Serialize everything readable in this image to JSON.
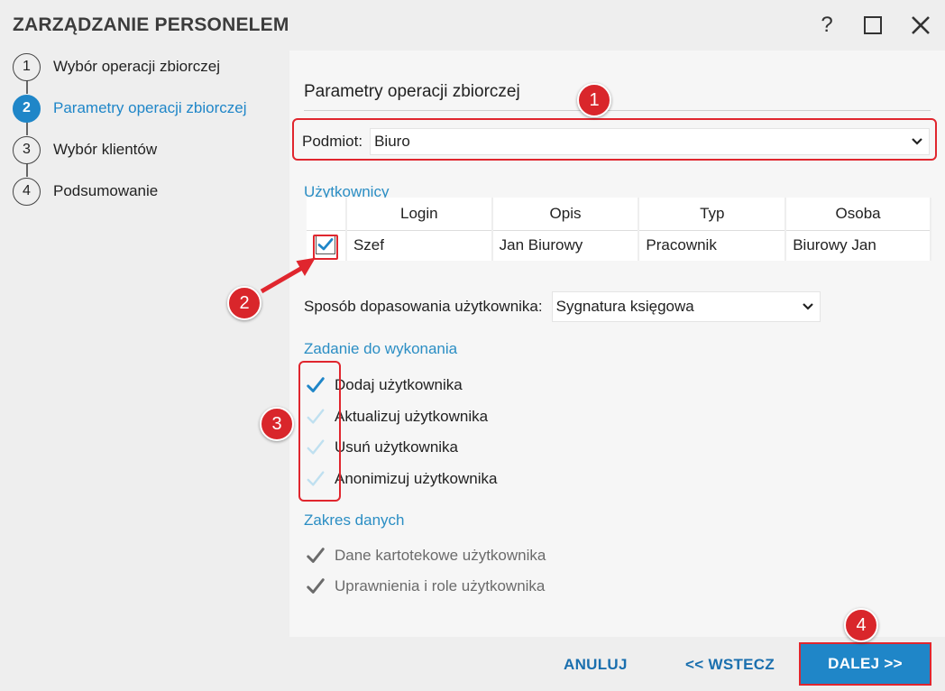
{
  "window": {
    "title": "ZARZĄDZANIE PERSONELEM",
    "help_label": "?"
  },
  "steps": [
    {
      "num": "1",
      "label": "Wybór operacji zbiorczej",
      "active": false
    },
    {
      "num": "2",
      "label": "Parametry operacji zbiorczej",
      "active": true
    },
    {
      "num": "3",
      "label": "Wybór klientów",
      "active": false
    },
    {
      "num": "4",
      "label": "Podsumowanie",
      "active": false
    }
  ],
  "main": {
    "section_title": "Parametry operacji zbiorczej",
    "podmiot": {
      "label": "Podmiot:",
      "value": "Biuro"
    },
    "users": {
      "group_label": "Użytkownicy",
      "columns": [
        "Login",
        "Opis",
        "Typ",
        "Osoba"
      ],
      "rows": [
        {
          "checked": true,
          "login": "Szef",
          "opis": "Jan Biurowy",
          "typ": "Pracownik",
          "osoba": "Biurowy Jan"
        }
      ]
    },
    "matching": {
      "label": "Sposób dopasowania użytkownika:",
      "value": "Sygnatura księgowa"
    },
    "task": {
      "group_label": "Zadanie do wykonania",
      "items": [
        {
          "label": "Dodaj użytkownika",
          "checked": true
        },
        {
          "label": "Aktualizuj użytkownika",
          "checked": false
        },
        {
          "label": "Usuń użytkownika",
          "checked": false
        },
        {
          "label": "Anonimizuj użytkownika",
          "checked": false
        }
      ]
    },
    "scope": {
      "group_label": "Zakres danych",
      "items": [
        {
          "label": "Dane kartotekowe użytkownika",
          "checked": true,
          "disabled": true
        },
        {
          "label": "Uprawnienia i role użytkownika",
          "checked": true,
          "disabled": true
        }
      ]
    }
  },
  "footer": {
    "cancel_label": "ANULUJ",
    "back_label": "<< WSTECZ",
    "next_label": "DALEJ >>"
  },
  "annotations": [
    "1",
    "2",
    "3",
    "4"
  ],
  "colors": {
    "accent": "#1f86c8",
    "annotation_red": "#d9262b",
    "check_active": "#1f86c8",
    "check_inactive": "#bfe0f0",
    "check_disabled": "#6b6b6b"
  }
}
